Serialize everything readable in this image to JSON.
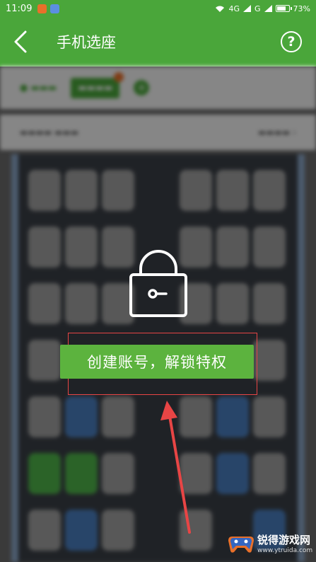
{
  "status_bar": {
    "time": "11:09",
    "network": "4G",
    "network2": "G",
    "battery": "73%",
    "notif1_color": "#e8702a",
    "notif2_color": "#5b8fe0"
  },
  "header": {
    "back_icon": "chevron-left-icon",
    "title": "手机选座",
    "help_label": "?"
  },
  "overlay": {
    "lock_icon": "lock-icon",
    "unlock_button_label": "创建账号，解锁特权"
  },
  "watermark": {
    "brand": "锐得游戏网",
    "url": "www.ytruida.com"
  },
  "colors": {
    "brand_green": "#4aa63a",
    "button_green": "#5cb33e",
    "highlight_red": "#e84545"
  }
}
